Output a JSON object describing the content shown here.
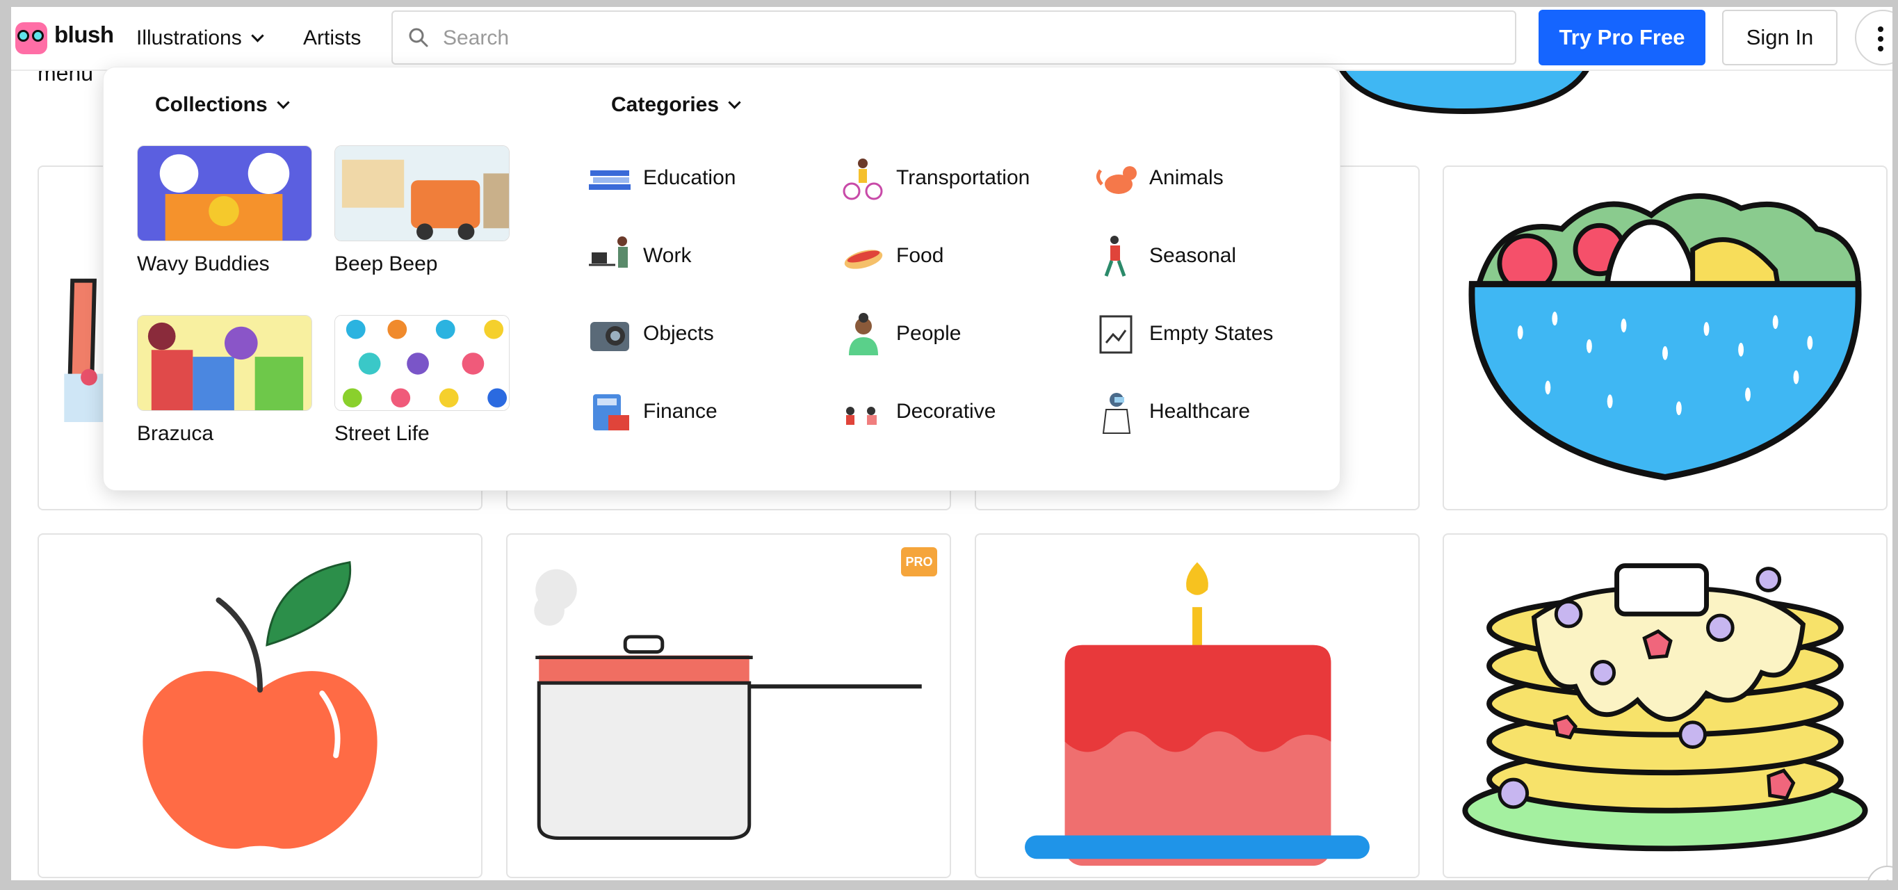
{
  "header": {
    "logo_text": "blush",
    "nav": {
      "illustrations": "Illustrations",
      "artists": "Artists"
    },
    "search": {
      "placeholder": "Search",
      "value": ""
    },
    "try_pro": "Try Pro Free",
    "sign_in": "Sign In"
  },
  "page": {
    "menu_stub": "menu"
  },
  "dropdown": {
    "collections_title": "Collections",
    "categories_title": "Categories",
    "collections": [
      {
        "label": "Wavy Buddies"
      },
      {
        "label": "Beep Beep"
      },
      {
        "label": "Brazuca"
      },
      {
        "label": "Street Life"
      }
    ],
    "categories": [
      {
        "label": "Education",
        "icon": "books-icon"
      },
      {
        "label": "Transportation",
        "icon": "bicycle-icon"
      },
      {
        "label": "Animals",
        "icon": "cat-icon"
      },
      {
        "label": "Work",
        "icon": "desk-icon"
      },
      {
        "label": "Food",
        "icon": "hotdog-icon"
      },
      {
        "label": "Seasonal",
        "icon": "dancer-icon"
      },
      {
        "label": "Objects",
        "icon": "camera-icon"
      },
      {
        "label": "People",
        "icon": "person-icon"
      },
      {
        "label": "Empty States",
        "icon": "document-icon"
      },
      {
        "label": "Finance",
        "icon": "calculator-icon"
      },
      {
        "label": "Decorative",
        "icon": "scene-icon"
      },
      {
        "label": "Healthcare",
        "icon": "doctor-icon"
      }
    ]
  },
  "grid": {
    "pro_badge": "PRO",
    "cards": [
      {
        "name": "drink-illustration"
      },
      {
        "name": "card-illustration-2"
      },
      {
        "name": "card-illustration-3"
      },
      {
        "name": "noodle-bowl-illustration"
      },
      {
        "name": "apple-illustration"
      },
      {
        "name": "cooking-pot-illustration",
        "pro": true
      },
      {
        "name": "birthday-cake-illustration"
      },
      {
        "name": "pancakes-illustration"
      }
    ]
  },
  "help": {
    "label": "?"
  },
  "colors": {
    "primary_button": "#1565ff",
    "pro_badge": "#f5a53b",
    "logo_pink": "#ff6ea6",
    "logo_teal": "#5fe3ea"
  }
}
